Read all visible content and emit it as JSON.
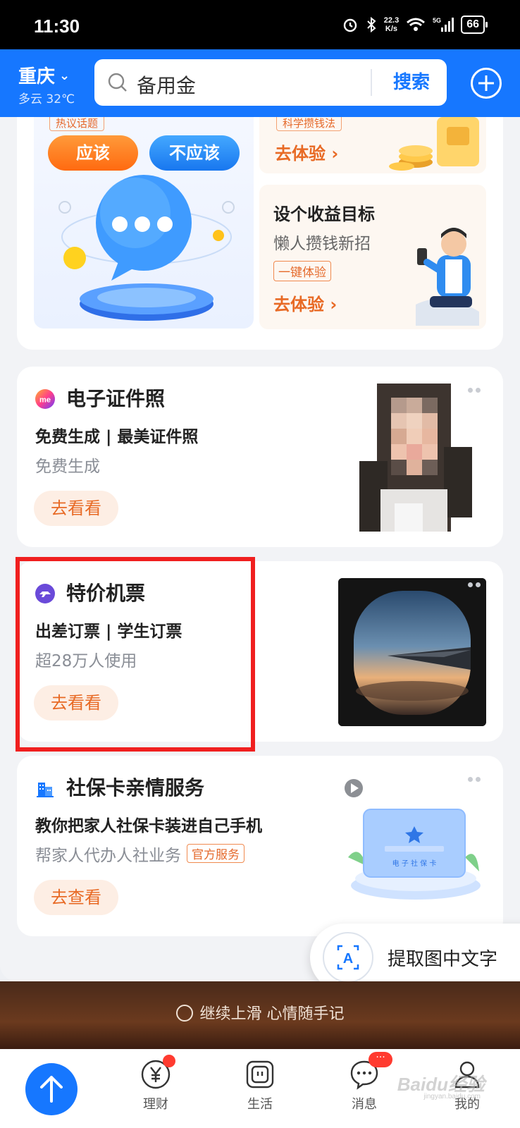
{
  "status_bar": {
    "time": "11:30",
    "net_speed_value": "22.3",
    "net_speed_unit": "K/s",
    "battery": "66"
  },
  "header": {
    "city": "重庆",
    "weather": "多云 32℃",
    "search_text": "备用金",
    "search_button": "搜索"
  },
  "promo": {
    "topic_tag": "热议话题",
    "vote_yes": "应该",
    "vote_no": "不应该",
    "save_tag": "科学攒钱法",
    "try_link_top": "去体验",
    "goal_title": "设个收益目标",
    "goal_sub": "懒人攒钱新招",
    "goal_tag": "一键体验",
    "try_link_bottom": "去体验"
  },
  "services": [
    {
      "title": "电子证件照",
      "desc": "免费生成 | 最美证件照",
      "sub": "免费生成",
      "button": "去看看"
    },
    {
      "title": "特价机票",
      "desc": "出差订票 | 学生订票",
      "sub": "超28万人使用",
      "button": "去看看"
    },
    {
      "title": "社保卡亲情服务",
      "desc": "教你把家人社保卡装进自己手机",
      "sub": "帮家人代办人社业务",
      "tag": "官方服务",
      "button": "去查看",
      "card_text": "电 子 社 保 卡"
    }
  ],
  "extract_text": "提取图中文字",
  "footer_hint": "继续上滑 心情随手记",
  "bottom_nav": {
    "items": [
      {
        "label": "理财",
        "icon": "yuan-icon"
      },
      {
        "label": "生活",
        "icon": "life-icon"
      },
      {
        "label": "消息",
        "icon": "message-icon",
        "badge": "···"
      },
      {
        "label": "我的",
        "icon": "profile-icon"
      }
    ]
  },
  "watermark": "Baidu经验",
  "watermark_sub": "jingyan.baidu.com",
  "colors": {
    "brand_blue": "#1677ff",
    "accent_orange": "#e86a25",
    "highlight_red": "#f01f1f"
  }
}
